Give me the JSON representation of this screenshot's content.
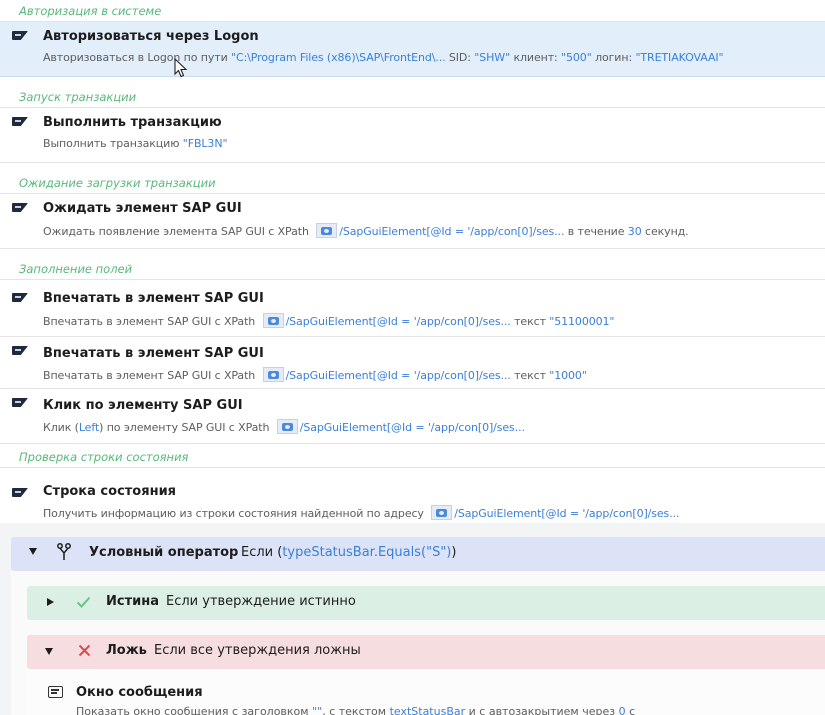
{
  "sections": {
    "auth": "Авторизация в системе",
    "launch": "Запуск транзакции",
    "wait_load": "Ожидание загрузки транзакции",
    "fill": "Заполнение полей",
    "status_check": "Проверка строки состояния"
  },
  "actions": {
    "logon": {
      "title": "Авторизоваться через Logon",
      "desc_prefix": "Авторизоваться в Logon по пути ",
      "path": "\"C:\\Program Files (x86)\\SAP\\FrontEnd\\...",
      "sid_label": " SID: ",
      "sid": "\"SHW\"",
      "client_label": " клиент: ",
      "client": "\"500\"",
      "login_label": " логин: ",
      "login": "\"TRETIAKOVAAI\""
    },
    "run_tx": {
      "title": "Выполнить транзакцию",
      "desc_prefix": "Выполнить транзакцию ",
      "tcode": "\"FBL3N\""
    },
    "wait_el": {
      "title": "Ожидать элемент SAP GUI",
      "desc_prefix": "Ожидать появление элемента SAP GUI с XPath ",
      "xpath": "/SapGuiElement[@Id = '/app/con[0]/ses...",
      "mid": " в течение ",
      "seconds": "30",
      "suffix": " секунд."
    },
    "type1": {
      "title": "Впечатать в элемент SAP GUI",
      "desc_prefix": "Впечатать в элемент SAP GUI с XPath ",
      "xpath": "/SapGuiElement[@Id = '/app/con[0]/ses...",
      "mid": " текст ",
      "text": "\"51100001\""
    },
    "type2": {
      "title": "Впечатать в элемент SAP GUI",
      "desc_prefix": "Впечатать в элемент SAP GUI с XPath ",
      "xpath": "/SapGuiElement[@Id = '/app/con[0]/ses...",
      "mid": " текст ",
      "text": "\"1000\""
    },
    "click": {
      "title": "Клик по элементу SAP GUI",
      "desc_prefix": "Клик (",
      "button": "Left",
      "desc_mid": ") по элементу SAP GUI с XPath ",
      "xpath": "/SapGuiElement[@Id = '/app/con[0]/ses..."
    },
    "status_bar": {
      "title": "Строка состояния",
      "desc_prefix": "Получить информацию из строки состояния найденной по адресу ",
      "xpath": "/SapGuiElement[@Id = '/app/con[0]/ses..."
    }
  },
  "condition": {
    "label": "Условный оператор",
    "if_word": "Если (",
    "expr": "typeStatusBar.Equals(\"S\")",
    "close": ")",
    "true_label": "Истина",
    "true_desc": "Если утверждение истинно",
    "false_label": "Ложь",
    "false_desc": "Если все утверждения ложны",
    "message": {
      "title": "Окно сообщения",
      "desc_prefix": "Показать окно сообщения с заголовком ",
      "caption": "\"\"",
      "desc_mid": ", с текстом ",
      "text_var": "textStatusBar",
      "desc_tail": " и с автозакрытием через ",
      "timeout": "0",
      "desc_end": " с"
    }
  },
  "colors": {
    "accent_blue": "#3a7fd8",
    "section_green": "#58b87a",
    "selected_bg": "#e3eefb",
    "cond_header_bg": "#dce3f6",
    "true_bg": "#dcefe5",
    "false_bg": "#f6dde0",
    "check_green": "#6cc28a",
    "cross_red": "#e04a4a"
  },
  "icons": [
    "sap-logo-icon",
    "camera-icon",
    "branch-icon",
    "check-icon",
    "close-icon",
    "message-icon",
    "mouse-cursor-icon"
  ]
}
